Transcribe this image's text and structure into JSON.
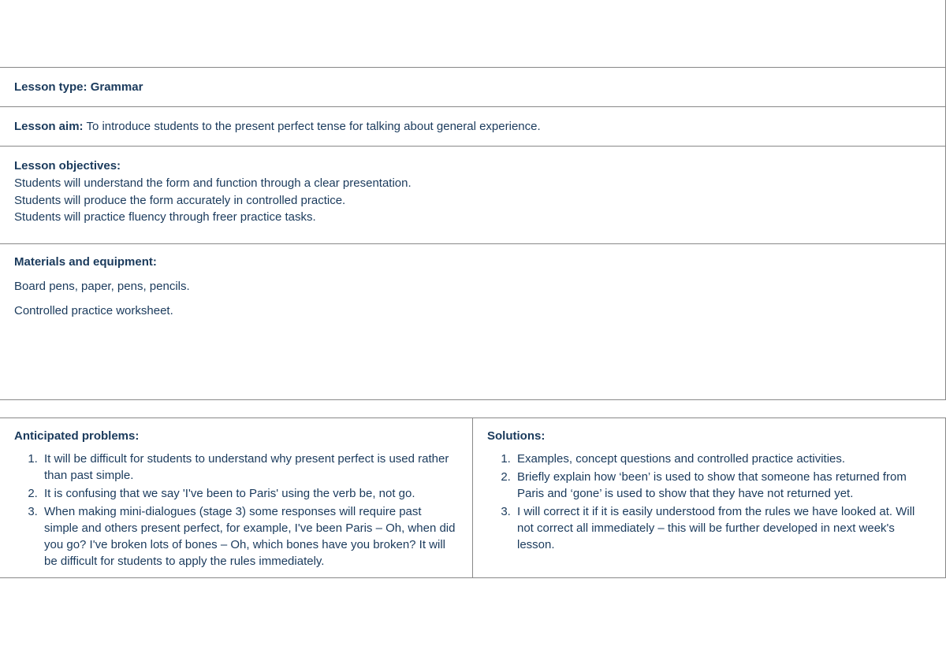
{
  "lessonType": {
    "label": "Lesson type:",
    "value": "Grammar"
  },
  "lessonAim": {
    "label": "Lesson aim:",
    "value": "To introduce students to the present perfect tense for talking about general experience."
  },
  "objectives": {
    "label": "Lesson objectives:",
    "lines": [
      "Students will understand the form and function through a clear presentation.",
      "Students will produce the form accurately in controlled practice.",
      "Students will practice fluency through freer practice tasks."
    ]
  },
  "materials": {
    "label": "Materials and equipment:",
    "lines": [
      "Board pens, paper, pens, pencils.",
      "Controlled practice worksheet."
    ]
  },
  "problems": {
    "label": "Anticipated problems:",
    "items": [
      "It will be difficult for students to understand why present perfect is used rather than past simple.",
      "It is confusing that we say 'I've been to Paris' using the verb be, not go.",
      "When making mini-dialogues (stage 3) some responses will require past simple and others present perfect, for example, I've been Paris – Oh, when did you go? I've broken lots of bones – Oh, which bones have you broken? It will be difficult for students to apply the rules immediately."
    ]
  },
  "solutions": {
    "label": "Solutions:",
    "items": [
      "Examples, concept questions and controlled practice activities.",
      "Briefly explain how ‘been’ is used to show that someone has returned from Paris and ‘gone’ is used to show that they have not returned yet.",
      "I will correct it if it is easily understood from the rules we have looked at. Will not correct all immediately – this will be further developed in next week's lesson."
    ]
  }
}
